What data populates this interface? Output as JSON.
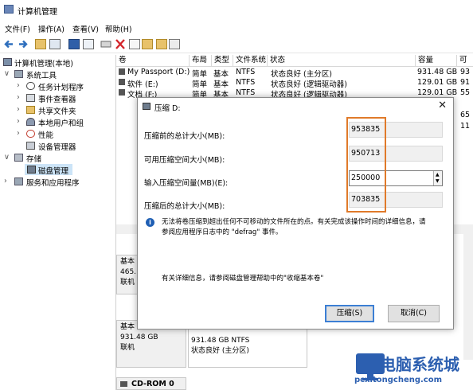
{
  "window": {
    "title": "计算机管理"
  },
  "menu": [
    "文件(F)",
    "操作(A)",
    "查看(V)",
    "帮助(H)"
  ],
  "tree": {
    "root": "计算机管理(本地)",
    "system_tools": "系统工具",
    "task_scheduler": "任务计划程序",
    "event_viewer": "事件查看器",
    "shared_folders": "共享文件夹",
    "local_users": "本地用户和组",
    "performance": "性能",
    "device_manager": "设备管理器",
    "storage": "存储",
    "disk_management": "磁盘管理",
    "services_apps": "服务和应用程序"
  },
  "volume_table": {
    "headers": [
      "卷",
      "布局",
      "类型",
      "文件系统",
      "状态",
      "容量",
      "可"
    ],
    "rows": [
      {
        "vol": "My Passport (D:)",
        "layout": "简单",
        "type": "基本",
        "fs": "NTFS",
        "status": "状态良好 (主分区)",
        "cap": "931.48 GB",
        "free": "93"
      },
      {
        "vol": "软件 (E:)",
        "layout": "简单",
        "type": "基本",
        "fs": "NTFS",
        "status": "状态良好 (逻辑驱动器)",
        "cap": "129.01 GB",
        "free": "91"
      },
      {
        "vol": "文档 (F:)",
        "layout": "简单",
        "type": "基本",
        "fs": "NTFS",
        "status": "状态良好 (逻辑驱动器)",
        "cap": "129.01 GB",
        "free": "55"
      }
    ],
    "right_partial": [
      "65",
      "11"
    ]
  },
  "lower": {
    "disk1": {
      "l1": "基本",
      "l2": "465.",
      "l3": "联机"
    },
    "disk2": {
      "l1": "基本",
      "l2": "931.48 GB",
      "l3": "联机"
    },
    "part2": {
      "l1": "931.48 GB NTFS",
      "l2": "状态良好 (主分区)"
    },
    "cdrom": "CD-ROM 0"
  },
  "dialog": {
    "title": "压缩 D:",
    "fields": [
      {
        "label": "压缩前的总计大小(MB):",
        "value": "953835"
      },
      {
        "label": "可用压缩空间大小(MB):",
        "value": "950713"
      },
      {
        "label": "输入压缩空间量(MB)(E):",
        "value": "250000"
      },
      {
        "label": "压缩后的总计大小(MB):",
        "value": "703835"
      }
    ],
    "info_line1": "无法将卷压缩到超出任何不可移动的文件所在的点。有关完成该操作时间的详细信息，请",
    "info_line2": "参阅应用程序日志中的 \"defrag\" 事件。",
    "help_text": "有关详细信息，请参阅磁盘管理帮助中的\"收缩基本卷\"",
    "ok_label": "压缩(S)",
    "cancel_label": "取消(C)"
  },
  "watermark": {
    "main": "电脑系统城",
    "sub": "pcxitongcheng.com"
  },
  "colors": {
    "highlight": "#e07a2a",
    "accent": "#3c7fd4",
    "selection": "#cce4f7"
  }
}
